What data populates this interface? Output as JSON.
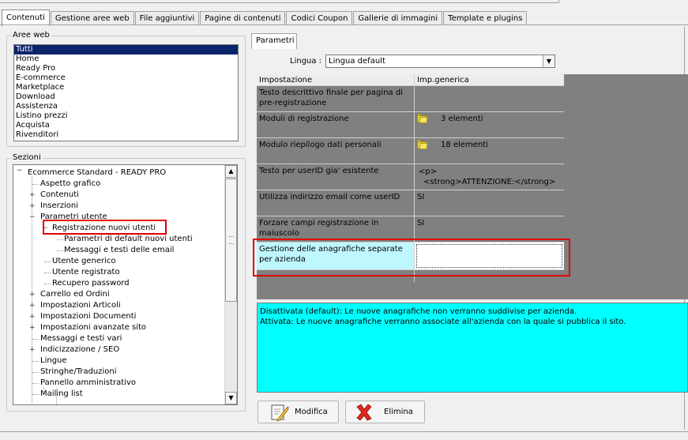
{
  "tabs": [
    "Contenuti",
    "Gestione aree web",
    "File aggiuntivi",
    "Pagine di contenuti",
    "Codici Coupon",
    "Gallerie di immagini",
    "Template e plugins"
  ],
  "aree_web": {
    "legend": "Aree web",
    "items": [
      "Tutti",
      "Home",
      "Ready Pro",
      "E-commerce",
      "Marketplace",
      "Download",
      "Assistenza",
      "Listino prezzi",
      "Acquista",
      "Rivenditori"
    ]
  },
  "sezioni": {
    "legend": "Sezioni",
    "root": "Ecommerce Standard - READY PRO",
    "items": [
      "Aspetto grafico",
      "Contenuti",
      "Inserzioni",
      "Parametri utente",
      "Registrazione nuovi utenti",
      "Parametri di default nuovi utenti",
      "Messaggi e testi delle email",
      "Utente generico",
      "Utente registrato",
      "Recupero password",
      "Carrello ed Ordini",
      "Impostazioni Articoli",
      "Impostazioni Documenti",
      "Impostazioni avanzate sito",
      "Messaggi e testi vari",
      "Indicizzazione / SEO",
      "Lingue",
      "Stringhe/Traduzioni",
      "Pannello amministrativo",
      "Mailing list"
    ]
  },
  "parametri": {
    "tab": "Parametri",
    "lingua_label": "Lingua :",
    "lingua_value": "Lingua default",
    "col1": "Impostazione",
    "col2": "Imp.generica",
    "rows": [
      {
        "name": "Testo descrittivo finale per pagina di pre-registrazione",
        "value": ""
      },
      {
        "name": "Moduli di registrazione",
        "value": "3 elementi"
      },
      {
        "name": "Modulo riepilogo dati personali",
        "value": "18 elementi"
      },
      {
        "name": "Testo per userID gia' esistente",
        "value": "<p>",
        "value2": "<strong>ATTENZIONE:</strong>"
      },
      {
        "name": "Utilizza indirizzo email come userID",
        "value": "SI"
      },
      {
        "name": "Forzare campi registrazione in maiuscolo",
        "value": "SI"
      },
      {
        "name": "Gestione delle anagrafiche separate per azienda",
        "value": ""
      }
    ],
    "desc1": "Disattivata (default): Le nuove anagrafiche non verranno suddivise per azienda.",
    "desc2": "Attivata: Le nuove anagrafiche verranno associate all'azienda con la quale si pubblica il sito."
  },
  "buttons": {
    "modifica": "Modifica",
    "elimina": "Elimina"
  },
  "colors": {
    "highlight": "#e00000",
    "selection": "#0a246a",
    "description_bg": "#00ffff"
  }
}
